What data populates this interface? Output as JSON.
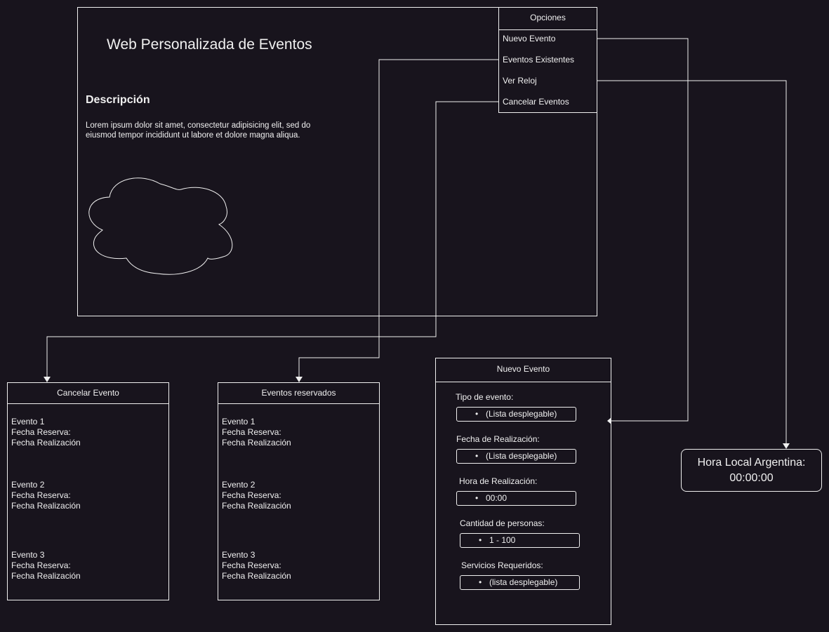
{
  "main": {
    "title": "Web Personalizada de Eventos",
    "description_heading": "Descripción",
    "description_text": "Lorem ipsum dolor sit amet, consectetur adipisicing elit, sed do eiusmod tempor incididunt ut labore et dolore magna aliqua."
  },
  "options_menu": {
    "header": "Opciones",
    "items": [
      "Nuevo Evento",
      "Eventos Existentes",
      "Ver Reloj",
      "Cancelar Eventos"
    ]
  },
  "cancel_panel": {
    "header": "Cancelar Evento",
    "events": [
      {
        "name": "Evento 1",
        "reserve": "Fecha Reserva:",
        "done": "Fecha Realización"
      },
      {
        "name": "Evento 2",
        "reserve": "Fecha Reserva:",
        "done": "Fecha Realización"
      },
      {
        "name": "Evento 3",
        "reserve": "Fecha Reserva:",
        "done": "Fecha Realización"
      }
    ]
  },
  "reserved_panel": {
    "header": "Eventos reservados",
    "events": [
      {
        "name": "Evento 1",
        "reserve": "Fecha Reserva:",
        "done": "Fecha Realización"
      },
      {
        "name": "Evento 2",
        "reserve": "Fecha Reserva:",
        "done": "Fecha Realización"
      },
      {
        "name": "Evento 3",
        "reserve": "Fecha Reserva:",
        "done": "Fecha Realización"
      }
    ]
  },
  "new_event_panel": {
    "header": "Nuevo Evento",
    "fields": [
      {
        "label": "Tipo de evento:",
        "value": "(Lista desplegable)"
      },
      {
        "label": "Fecha de Realización:",
        "value": "(Lista desplegable)"
      },
      {
        "label": "Hora de Realización:",
        "value": "00:00"
      },
      {
        "label": "Cantidad de personas:",
        "value": "1 - 100"
      },
      {
        "label": "Servicios Requeridos:",
        "value": "(lista desplegable)"
      }
    ]
  },
  "clock": {
    "label": "Hora Local Argentina:",
    "time": "00:00:00"
  },
  "colors": {
    "background": "#18141d",
    "stroke": "#f0f0f0"
  },
  "icons": {
    "cloud": "cloud-icon",
    "bullet": "•"
  }
}
